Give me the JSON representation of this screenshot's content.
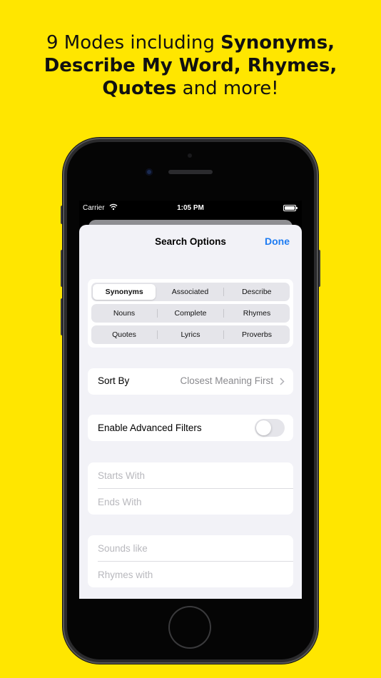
{
  "headline": {
    "line1_regular": "9 Modes including ",
    "line1_bold": "Synonyms,",
    "line2_bold": "Describe My Word, Rhymes,",
    "line3_bold": "Quotes",
    "line3_regular": " and more!"
  },
  "statusbar": {
    "carrier": "Carrier",
    "time": "1:05 PM"
  },
  "nav": {
    "title": "Search Options",
    "done_label": "Done"
  },
  "modes": {
    "rows": [
      [
        "Synonyms",
        "Associated",
        "Describe"
      ],
      [
        "Nouns",
        "Complete",
        "Rhymes"
      ],
      [
        "Quotes",
        "Lyrics",
        "Proverbs"
      ]
    ],
    "selected": "Synonyms"
  },
  "sort": {
    "label": "Sort By",
    "value": "Closest Meaning First"
  },
  "advanced": {
    "label": "Enable Advanced Filters",
    "enabled": false
  },
  "filters": {
    "starts_with_placeholder": "Starts With",
    "ends_with_placeholder": "Ends With",
    "sounds_like_placeholder": "Sounds like",
    "rhymes_with_placeholder": "Rhymes with"
  },
  "colors": {
    "background": "#FFE600",
    "accent": "#1E7CF2",
    "sheet": "#F2F2F7"
  }
}
